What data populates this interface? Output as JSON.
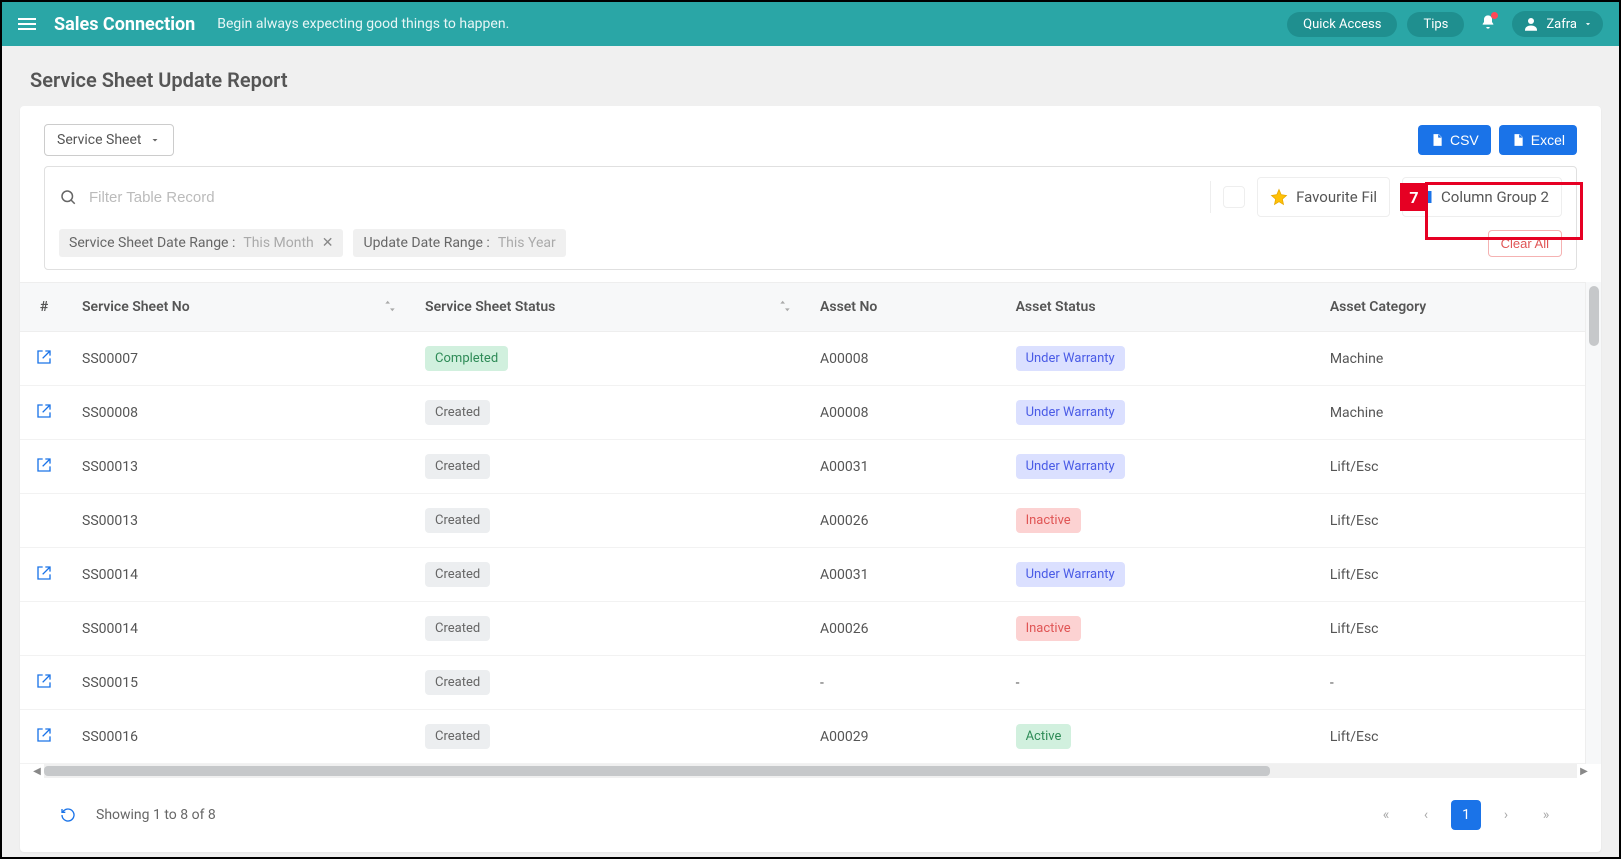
{
  "header": {
    "brand": "Sales Connection",
    "motto": "Begin always expecting good things to happen.",
    "quick_access": "Quick Access",
    "tips": "Tips",
    "username": "Zafra"
  },
  "page": {
    "title": "Service Sheet Update Report",
    "selector": "Service Sheet",
    "csv": "CSV",
    "excel": "Excel"
  },
  "filter": {
    "placeholder": "Filter Table Record",
    "favourite": "Favourite Fil",
    "column_group": "Column Group 2",
    "callout_num": "7",
    "chip1_label": "Service Sheet Date Range :",
    "chip1_val": "This Month",
    "chip2_label": "Update Date Range :",
    "chip2_val": "This Year",
    "clear_all": "Clear All"
  },
  "columns": {
    "hash": "#",
    "sheet_no": "Service Sheet No",
    "sheet_status": "Service Sheet Status",
    "asset_no": "Asset No",
    "asset_status": "Asset Status",
    "asset_cat": "Asset Category"
  },
  "rows": [
    {
      "open": true,
      "no": "SS00007",
      "status": "Completed",
      "status_cls": "b-completed",
      "asset": "A00008",
      "astatus": "Under Warranty",
      "astatus_cls": "b-warranty",
      "cat": "Machine"
    },
    {
      "open": true,
      "no": "SS00008",
      "status": "Created",
      "status_cls": "b-created",
      "asset": "A00008",
      "astatus": "Under Warranty",
      "astatus_cls": "b-warranty",
      "cat": "Machine"
    },
    {
      "open": true,
      "no": "SS00013",
      "status": "Created",
      "status_cls": "b-created",
      "asset": "A00031",
      "astatus": "Under Warranty",
      "astatus_cls": "b-warranty",
      "cat": "Lift/Esc"
    },
    {
      "open": false,
      "no": "SS00013",
      "status": "Created",
      "status_cls": "b-created",
      "asset": "A00026",
      "astatus": "Inactive",
      "astatus_cls": "b-inactive",
      "cat": "Lift/Esc"
    },
    {
      "open": true,
      "no": "SS00014",
      "status": "Created",
      "status_cls": "b-created",
      "asset": "A00031",
      "astatus": "Under Warranty",
      "astatus_cls": "b-warranty",
      "cat": "Lift/Esc"
    },
    {
      "open": false,
      "no": "SS00014",
      "status": "Created",
      "status_cls": "b-created",
      "asset": "A00026",
      "astatus": "Inactive",
      "astatus_cls": "b-inactive",
      "cat": "Lift/Esc"
    },
    {
      "open": true,
      "no": "SS00015",
      "status": "Created",
      "status_cls": "b-created",
      "asset": "-",
      "astatus": "-",
      "astatus_cls": "",
      "cat": "-"
    },
    {
      "open": true,
      "no": "SS00016",
      "status": "Created",
      "status_cls": "b-created",
      "asset": "A00029",
      "astatus": "Active",
      "astatus_cls": "b-active",
      "cat": "Lift/Esc"
    }
  ],
  "footer": {
    "showing": "Showing 1 to 8 of 8",
    "page": "1"
  }
}
